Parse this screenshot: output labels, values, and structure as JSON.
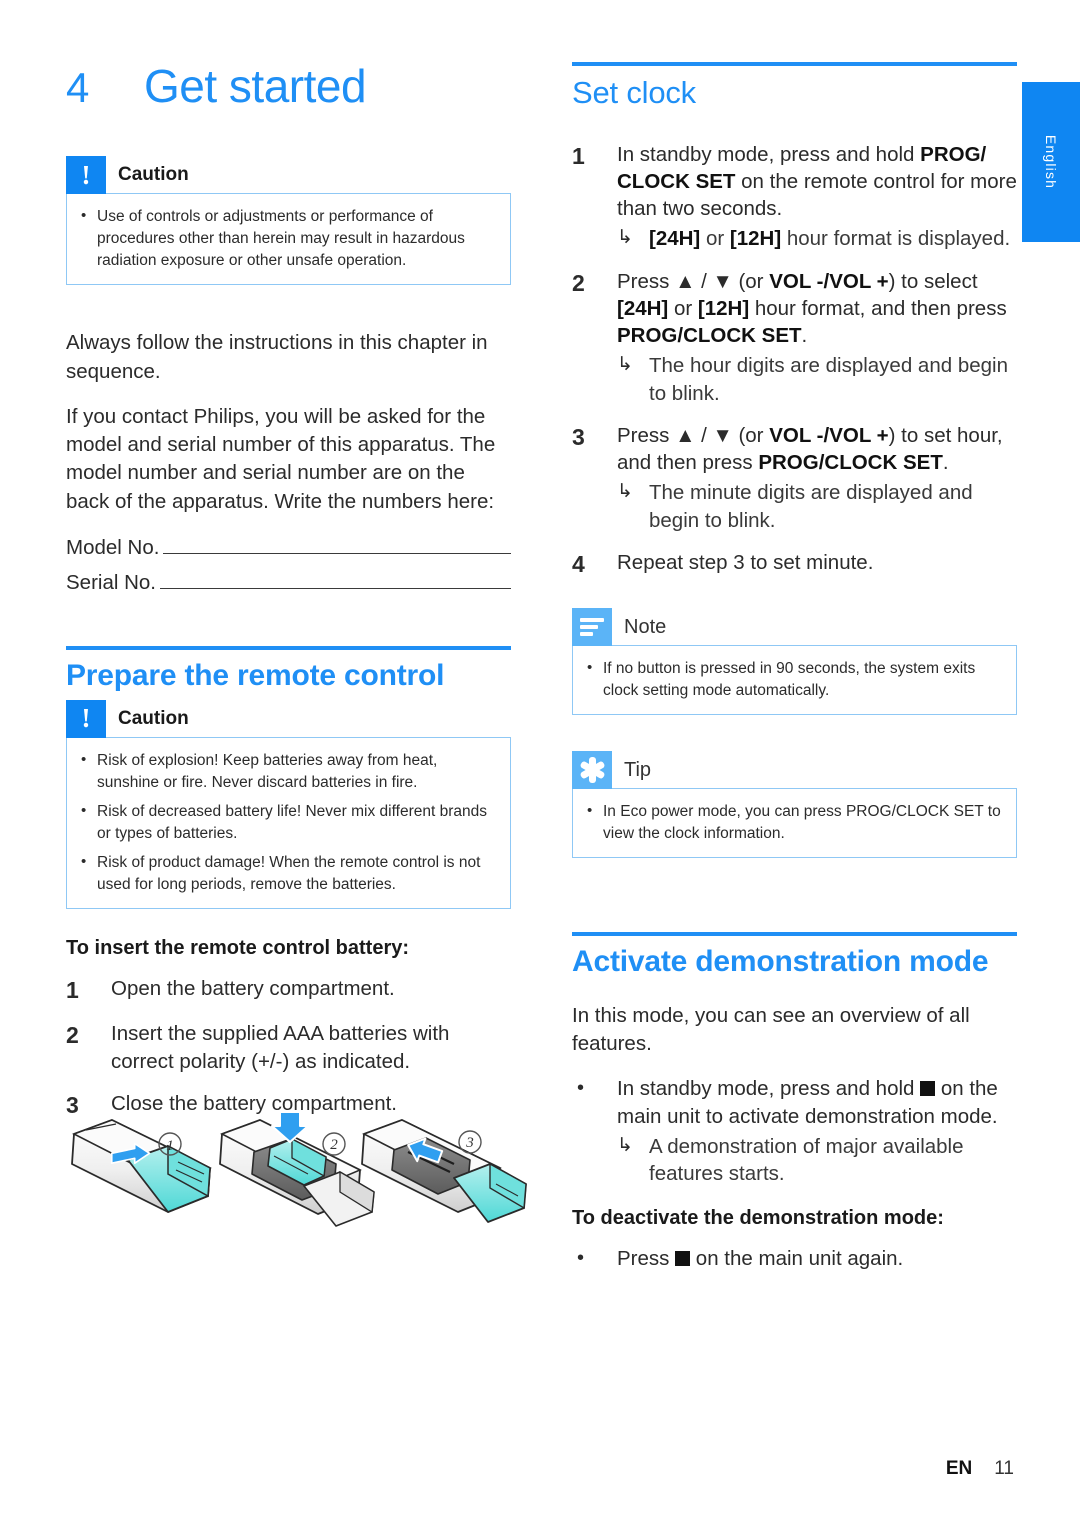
{
  "colors": {
    "accent": "#1f8ff5",
    "accent_strong": "#0f86f2",
    "accent_light": "#5bb4f7",
    "box_border": "#8fc8f5",
    "text": "#2b2b2b"
  },
  "side_tab": {
    "label": "English"
  },
  "footer": {
    "lang_code": "EN",
    "page_number": "11"
  },
  "chapter": {
    "number": "4",
    "title": "Get started"
  },
  "left_column": {
    "caution_top": {
      "icon": "exclamation-icon",
      "label": "Caution",
      "items": [
        "Use of controls or adjustments or performance of procedures other than herein may result in hazardous radiation exposure or other unsafe operation."
      ]
    },
    "paragraphs": [
      "Always follow the instructions in this chapter in sequence.",
      "If you contact Philips, you will be asked for the model and serial number of this apparatus. The model number and serial number are on the back of the apparatus. Write the numbers here:"
    ],
    "fill_in": [
      {
        "label": "Model No."
      },
      {
        "label": "Serial No."
      }
    ],
    "prepare_section": {
      "title": "Prepare the remote control",
      "caution": {
        "icon": "exclamation-icon",
        "label": "Caution",
        "items": [
          "Risk of explosion! Keep batteries away from heat, sunshine or fire. Never discard batteries in fire.",
          "Risk of decreased battery life! Never mix different brands or types of batteries.",
          "Risk of product damage! When the remote control is not used for long periods, remove the batteries."
        ]
      },
      "subhead": "To insert the remote control battery:",
      "steps": [
        {
          "num": "1",
          "text": "Open the battery compartment."
        },
        {
          "num": "2",
          "text": "Insert the supplied AAA batteries with correct polarity (+/-) as indicated."
        },
        {
          "num": "3",
          "text": "Close the battery compartment."
        }
      ],
      "illustration": {
        "name": "remote-battery-insertion-illustration",
        "callouts": [
          "1",
          "2",
          "3"
        ]
      }
    }
  },
  "right_column": {
    "set_clock": {
      "title": "Set clock",
      "steps": [
        {
          "num": "1",
          "html": "In standby mode, press and hold <b>PROG/ CLOCK SET</b> on the remote control for more than two seconds.",
          "result": "<b>[24H]</b> or <b>[12H]</b> hour format is displayed."
        },
        {
          "num": "2",
          "html": "Press ▲ / ▼ (or <b>VOL -/VOL +</b>) to select <b>[24H]</b> or <b>[12H]</b> hour format, and then press <b>PROG/CLOCK SET</b>.",
          "result": "The hour digits are displayed and begin to blink."
        },
        {
          "num": "3",
          "html": "Press ▲ / ▼ (or <b>VOL -/VOL +</b>) to set hour, and then press <b>PROG/CLOCK SET</b>.",
          "result": "The minute digits are displayed and begin to blink."
        },
        {
          "num": "4",
          "html": "Repeat step 3 to set minute.",
          "result": ""
        }
      ],
      "note": {
        "icon": "note-lines-icon",
        "label": "Note",
        "items": [
          "If no button is pressed in 90 seconds, the system exits clock setting mode automatically."
        ]
      },
      "tip": {
        "icon": "starburst-icon",
        "label": "Tip",
        "items": [
          "In Eco power mode, you can press PROG/CLOCK SET to view the clock information."
        ]
      }
    },
    "demo_mode": {
      "title": "Activate demonstration mode",
      "intro": "In this mode, you can see an overview of all features.",
      "bullet": {
        "html": "In standby mode, press and hold <span class=\"sqr\"></span> on the main unit to activate demonstration mode.",
        "result": "A demonstration of major available features starts."
      },
      "subhead": "To deactivate the demonstration mode:",
      "deactivate_bullet": {
        "html": "Press <span class=\"sqr\"></span> on the main unit again."
      }
    }
  },
  "glyphs": {
    "bullet": "•",
    "result_arrow": "↳",
    "up_triangle": "▲",
    "down_triangle": "▼"
  }
}
